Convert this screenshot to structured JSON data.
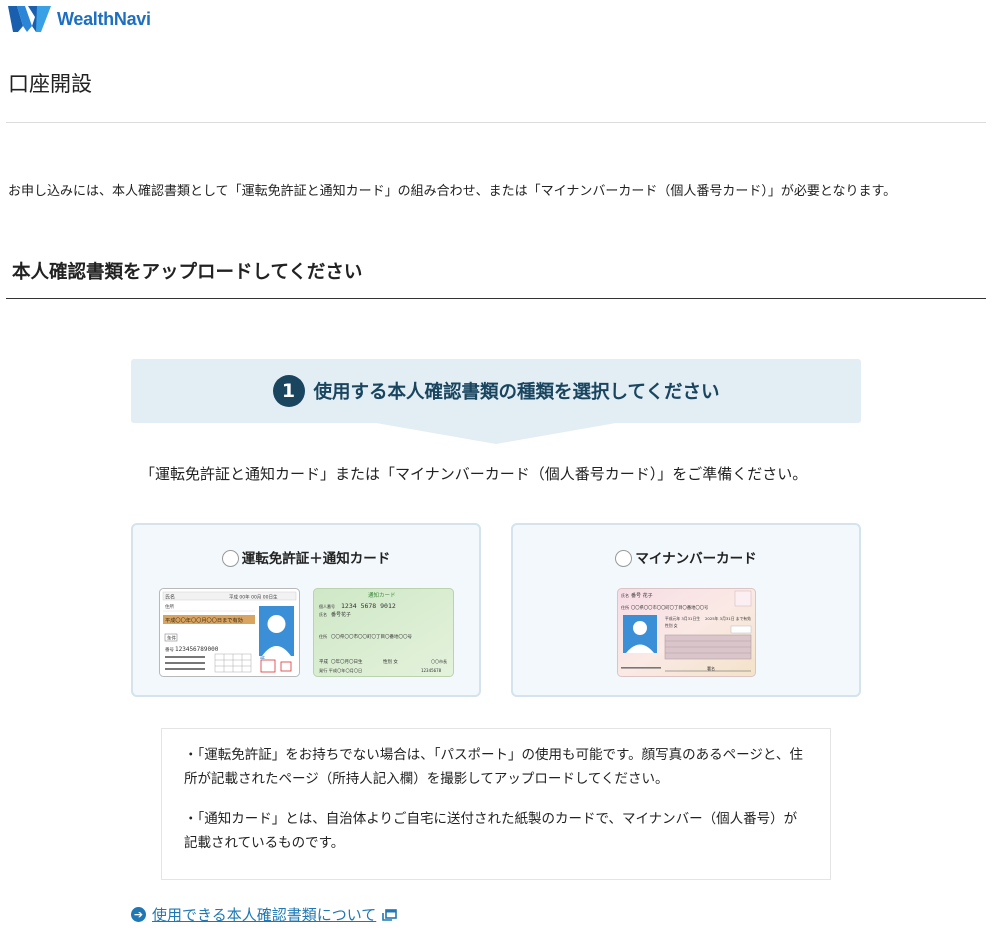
{
  "brand": {
    "name": "WealthNavi"
  },
  "page": {
    "title": "口座開設"
  },
  "intro": "お申し込みには、本人確認書類として「運転免許証と通知カード」の組み合わせ、または「マイナンバーカード（個人番号カード）」が必要となります。",
  "section": {
    "title": "本人確認書類をアップロードしてください"
  },
  "step": {
    "number": "1",
    "title": "使用する本人確認書類の種類を選択してください"
  },
  "prep_text": "「運転免許証と通知カード」または「マイナンバーカード（個人番号カード）」をご準備ください。",
  "options": [
    {
      "label": "運転免許証＋通知カード",
      "selected": false,
      "license_card": {
        "name_label": "氏名",
        "birth": "平成 00年 00月 00日生",
        "address_label": "住所",
        "expiry": "平成〇〇年〇〇月〇〇日まで有効",
        "number_label": "番号",
        "number": "123456789000",
        "type": "運転免許証"
      },
      "notice_card": {
        "title": "通知カード",
        "number_label": "個人番号",
        "number": "1234 5678 9012",
        "name_label": "氏名",
        "name": "番号花子",
        "address_label": "住所",
        "address": "〇〇県〇〇市〇〇町〇丁目〇番地〇〇号",
        "birth_label": "平成",
        "birth": "〇年〇月〇日生",
        "sex": "性別 女",
        "issued": "発行 平成〇年〇月〇日",
        "city": "〇〇市長",
        "code": "12345678"
      }
    },
    {
      "label": "マイナンバーカード",
      "selected": false,
      "mynumber_card": {
        "name_label": "氏名",
        "name": "番号 花子",
        "address_label": "住所",
        "address": "〇〇県〇〇市〇〇町〇丁目〇番地〇〇号",
        "birth": "平成元年 3月31日生",
        "sex": "性別 女",
        "expiry": "2025年 3月31日 まで有効",
        "signature_label": "署名"
      }
    }
  ],
  "notes": [
    "・「運転免許証」をお持ちでない場合は、「パスポート」の使用も可能です。顔写真のあるページと、住所が記載されたページ（所持人記入欄）を撮影してアップロードしてください。",
    "・「通知カード」とは、自治体よりご自宅に送付された紙製のカードで、マイナンバー（個人番号）が記載されているものです。"
  ],
  "link": {
    "label": "使用できる本人確認書類について",
    "icon": "arrow-right-circle-icon",
    "ext_icon": "external-window-icon"
  },
  "colors": {
    "brand": "#1e6fc1",
    "accent": "#19455f",
    "link": "#1f78b4",
    "step_bg": "#e3edf4",
    "card_bg": "#f2f8fb"
  }
}
